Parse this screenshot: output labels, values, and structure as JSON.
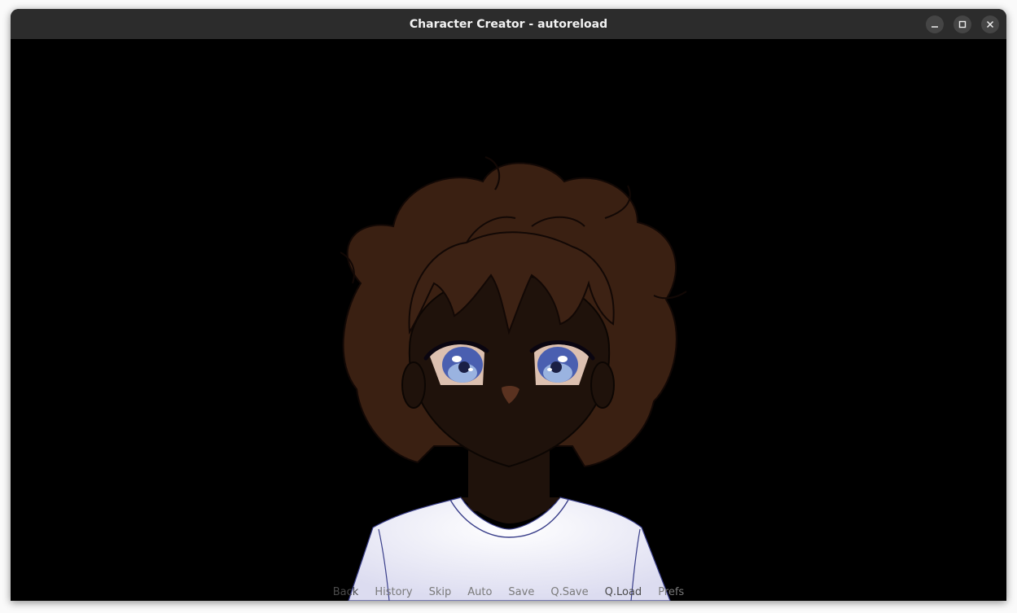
{
  "window": {
    "title": "Character Creator - autoreload",
    "controls": [
      "minimize-icon",
      "maximize-icon",
      "close-icon"
    ]
  },
  "character": {
    "hair_color": "#3a2012",
    "skin_color": "#1f120b",
    "eye_color": "#4a5fb0",
    "shirt_color": "#e8e8f6",
    "shirt_outline": "#3a3f8a"
  },
  "quick_menu": {
    "back": "Back",
    "history": "History",
    "skip": "Skip",
    "auto": "Auto",
    "save": "Save",
    "qsave": "Q.Save",
    "qload": "Q.Load",
    "prefs": "Prefs"
  }
}
